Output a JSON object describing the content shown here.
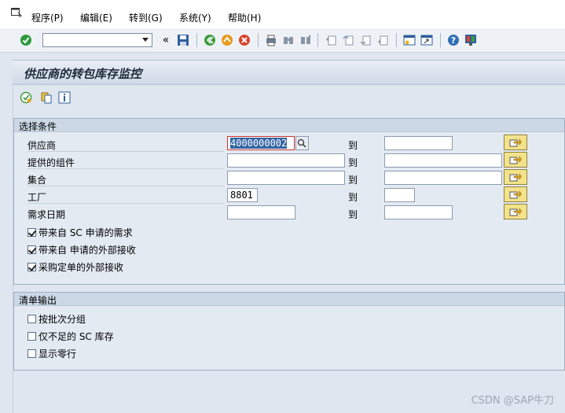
{
  "menu": {
    "items": [
      "程序(P)",
      "编辑(E)",
      "转到(G)",
      "系统(Y)",
      "帮助(H)"
    ]
  },
  "toolbar": {
    "command_field": "",
    "icons": [
      "enter-icon",
      "save-icon",
      "back-icon",
      "exit-icon",
      "cancel-icon",
      "print-icon",
      "find-icon",
      "find-next-icon",
      "first-page-icon",
      "prev-page-icon",
      "next-page-icon",
      "last-page-icon",
      "create-session-icon",
      "shortcut-icon",
      "help-icon",
      "layout-icon"
    ]
  },
  "title": "供应商的转包库存监控",
  "app_toolbar": [
    "execute-icon",
    "copy-variant-icon",
    "info-icon"
  ],
  "selection": {
    "title": "选择条件",
    "to_label": "到",
    "rows": [
      {
        "label": "供应商",
        "from": "4000000002",
        "to": ""
      },
      {
        "label": "提供的组件",
        "from": "",
        "to": ""
      },
      {
        "label": "集合",
        "from": "",
        "to": ""
      },
      {
        "label": "工厂",
        "from": "8801",
        "to": ""
      },
      {
        "label": "需求日期",
        "from": "",
        "to": ""
      }
    ],
    "checkboxes": [
      {
        "label": "带来自 SC 申请的需求",
        "checked": true
      },
      {
        "label": "带来自 申请的外部接收",
        "checked": true
      },
      {
        "label": "采购定单的外部接收",
        "checked": true
      }
    ]
  },
  "output": {
    "title": "清单输出",
    "checkboxes": [
      {
        "label": "按批次分组",
        "checked": false
      },
      {
        "label": "仅不足的 SC 库存",
        "checked": false
      },
      {
        "label": "显示零行",
        "checked": false
      }
    ]
  },
  "watermark": "CSDN @SAP牛刀",
  "colors": {
    "accent_button": "#f4e28a",
    "selection_highlight": "#3465a4"
  }
}
